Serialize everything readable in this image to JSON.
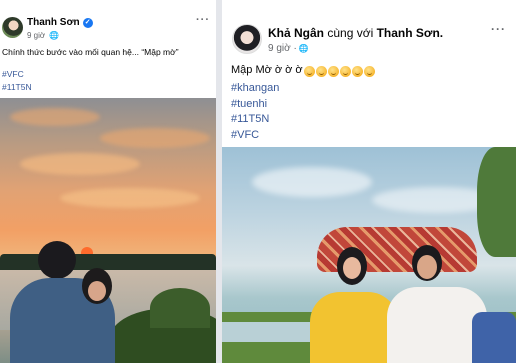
{
  "left_post": {
    "author": "Thanh Sơn",
    "time": "9 giờ",
    "caption": "Chính thức bước vào mối quan hệ... “Mập mờ”",
    "hashtags": [
      "#VFC",
      "#11T5N"
    ],
    "verified_icon": "verified-badge-icon",
    "menu_icon": "more-options-icon"
  },
  "right_post": {
    "author": "Khả Ngân",
    "with_text": "cùng với",
    "tagged": "Thanh Sơn.",
    "time": "9 giờ ·",
    "caption": "Mập Mờ ờ ờ ờ",
    "emoji_count": 6,
    "hashtags": [
      "#khangan",
      "#tuenhi",
      "#11T5N",
      "#VFC"
    ],
    "menu_icon": "more-options-icon"
  },
  "colors": {
    "hashtag": "#385898",
    "meta": "#65676b",
    "verified": "#1877f2"
  }
}
